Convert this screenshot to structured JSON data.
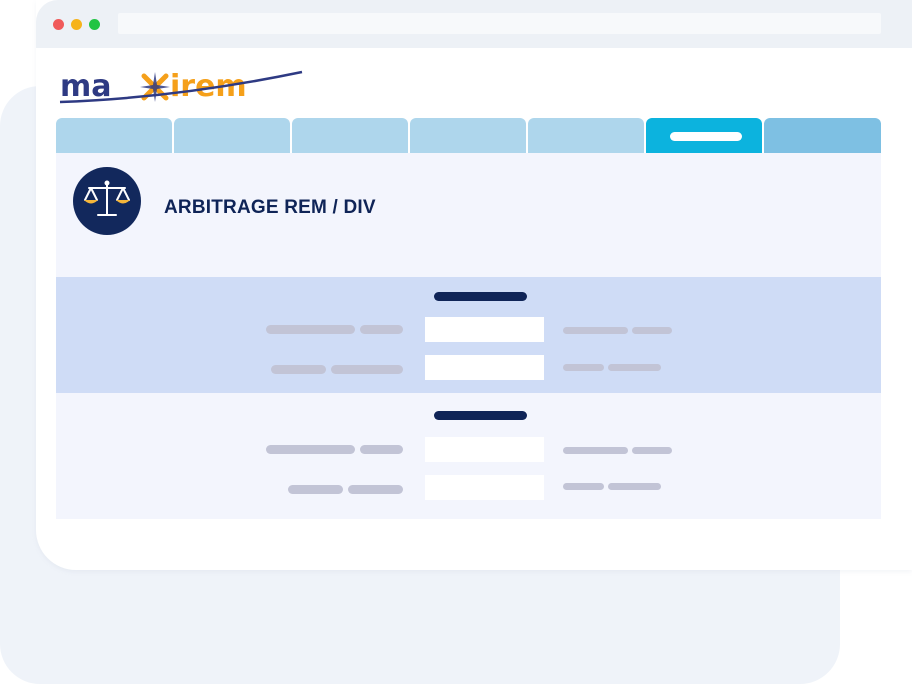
{
  "app": {
    "brand_logo_text": "maxirem",
    "page_title": "ARBITRAGE REM / DIV"
  },
  "tabs": [
    {
      "label": "",
      "active": false
    },
    {
      "label": "",
      "active": false
    },
    {
      "label": "",
      "active": false
    },
    {
      "label": "",
      "active": false
    },
    {
      "label": "",
      "active": false
    },
    {
      "label": "",
      "active": true
    },
    {
      "label": "",
      "active": false
    }
  ],
  "colors": {
    "brand_navy": "#0f2457",
    "brand_orange": "#f5a01a",
    "tab_inactive": "#aed6ec",
    "tab_active": "#0cb3de",
    "tab_last": "#7ec0e3",
    "section_highlight": "#cfdcf6",
    "panel_background": "#f3f5fd"
  },
  "icons": {
    "emblem": "balance-scale-icon"
  },
  "sections": [
    {
      "heading": "",
      "rows": [
        {
          "label": "",
          "value": "",
          "hint": ""
        },
        {
          "label": "",
          "value": "",
          "hint": ""
        }
      ]
    },
    {
      "heading": "",
      "rows": [
        {
          "label": "",
          "value": "",
          "hint": ""
        },
        {
          "label": "",
          "value": "",
          "hint": ""
        }
      ]
    }
  ]
}
